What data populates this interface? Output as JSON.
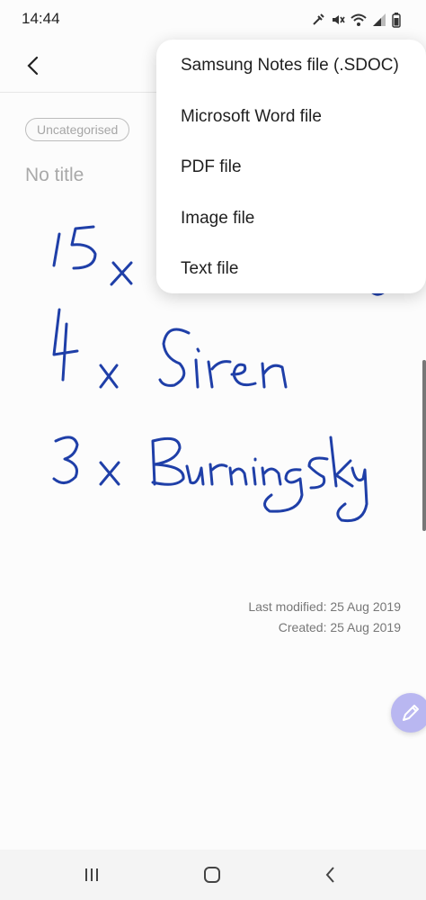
{
  "status": {
    "time": "14:44"
  },
  "note": {
    "category": "Uncategorised",
    "title": "No title",
    "handwriting": [
      "15 x",
      "4 x Siren",
      "3 x Burning Sky"
    ],
    "last_modified": "Last modified: 25 Aug 2019",
    "created": "Created: 25 Aug 2019"
  },
  "save_menu": {
    "items": [
      "Samsung Notes file (.SDOC)",
      "Microsoft Word file",
      "PDF file",
      "Image file",
      "Text file"
    ]
  },
  "icons": {
    "back": "chevron-left-icon",
    "edit": "pen-icon",
    "nav_recent": "recent-apps-icon",
    "nav_home": "home-icon",
    "nav_back": "back-icon"
  },
  "colors": {
    "ink": "#1f3fa8",
    "fab": "#b9b7f1"
  }
}
